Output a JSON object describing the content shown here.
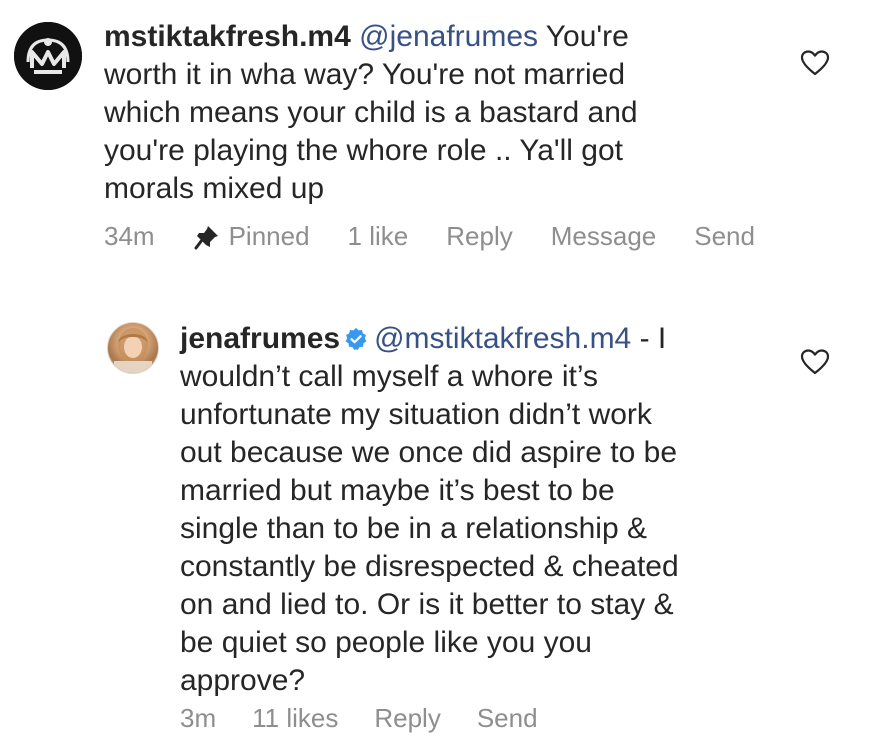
{
  "comments": [
    {
      "username": "mstiktakfresh.m4",
      "mention": "@jenafrumes",
      "text": " You're\nworth it in wha way? You're not married\nwhich means your child is a bastard and\nyou're playing the whore role .. Ya'll got\nmorals mixed up",
      "avatar": "m4-logo-icon",
      "time": "34m",
      "pinned_label": "Pinned",
      "likes": "1 like",
      "reply_label": "Reply",
      "message_label": "Message",
      "send_label": "Send"
    },
    {
      "username": "jenafrumes",
      "verified": true,
      "mention": "@mstiktakfresh.m4",
      "text": " - I\nwouldn’t call myself a whore it’s\nunfortunate my situation didn’t work\nout because we once did aspire to be\nmarried but maybe it’s best to be\nsingle than to be in a relationship &\nconstantly be disrespected & cheated\non and lied to. Or is it better to stay &\nbe quiet so people like you you\napprove?",
      "avatar": "profile-photo",
      "time": "3m",
      "likes": "11 likes",
      "reply_label": "Reply",
      "send_label": "Send"
    }
  ],
  "colors": {
    "text": "#262626",
    "mention": "#385185",
    "meta": "#8e8e8e",
    "verified": "#3897f0"
  }
}
